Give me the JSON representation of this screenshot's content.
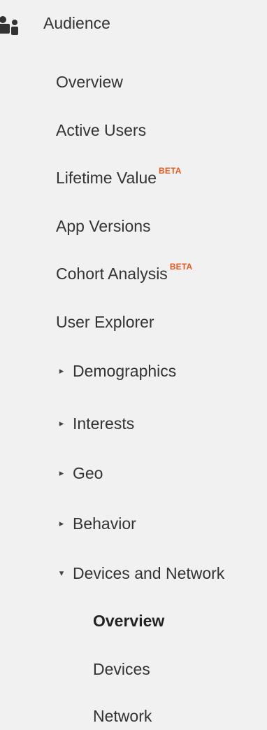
{
  "section": {
    "label": "Audience",
    "icon": "audience-icon"
  },
  "items": [
    {
      "label": "Overview"
    },
    {
      "label": "Active Users"
    },
    {
      "label": "Lifetime Value",
      "badge": "BETA"
    },
    {
      "label": "App Versions"
    },
    {
      "label": "Cohort Analysis",
      "badge": "BETA"
    },
    {
      "label": "User Explorer"
    },
    {
      "label": "Demographics",
      "caret": "▸",
      "expanded": false
    },
    {
      "label": "Interests",
      "caret": "▸",
      "expanded": false
    },
    {
      "label": "Geo",
      "caret": "▸",
      "expanded": false
    },
    {
      "label": "Behavior",
      "caret": "▸",
      "expanded": false
    },
    {
      "label": "Devices and Network",
      "caret": "▾",
      "expanded": true
    }
  ],
  "subitems": [
    {
      "label": "Overview",
      "active": true
    },
    {
      "label": "Devices",
      "active": false
    },
    {
      "label": "Network",
      "active": false
    }
  ],
  "colors": {
    "background": "#f1f1f1",
    "text": "#333333",
    "beta": "#e8581b"
  }
}
